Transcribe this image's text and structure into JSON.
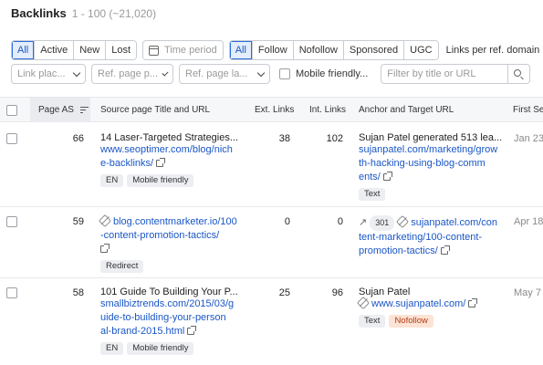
{
  "header": {
    "title": "Backlinks",
    "count": "1 - 100 (~21,020)"
  },
  "status_filter": [
    {
      "label": "All",
      "active": true
    },
    {
      "label": "Active",
      "active": false
    },
    {
      "label": "New",
      "active": false
    },
    {
      "label": "Lost",
      "active": false
    }
  ],
  "time_period_placeholder": "Time period",
  "type_filter": [
    {
      "label": "All",
      "active": true
    },
    {
      "label": "Follow",
      "active": false
    },
    {
      "label": "Nofollow",
      "active": false
    },
    {
      "label": "Sponsored",
      "active": false
    },
    {
      "label": "UGC",
      "active": false
    }
  ],
  "links_per_ref_domain": "Links per ref. domain",
  "dropdowns": {
    "link_placement": "Link plac...",
    "ref_page_p": "Ref. page p...",
    "ref_page_la": "Ref. page la..."
  },
  "mobile_friendly_label": "Mobile friendly...",
  "filter_placeholder": "Filter by title or URL",
  "columns": {
    "page_as": "Page AS",
    "source": "Source page Title and URL",
    "ext_links": "Ext. Links",
    "int_links": "Int. Links",
    "anchor": "Anchor and Target URL",
    "first_seen": "First Se"
  },
  "rows": [
    {
      "page_as": "66",
      "title": "14 Laser-Targeted Strategies...",
      "source_url_lines": [
        "www.seoptimer.com/blog/nich",
        "e-backlinks/"
      ],
      "source_tags": [
        "EN",
        "Mobile friendly"
      ],
      "ext_links": "38",
      "int_links": "102",
      "anchor_text": "Sujan Patel generated 513 lea...",
      "target_url_lines": [
        "sujanpatel.com/marketing/grow",
        "th-hacking-using-blog-comm",
        "ents/"
      ],
      "anchor_tags": [
        "Text"
      ],
      "first_seen": "Jan 23"
    },
    {
      "page_as": "59",
      "source_url_lines": [
        "blog.contentmarketer.io/100",
        "-content-promotion-tactics/"
      ],
      "source_tags": [
        "Redirect"
      ],
      "ext_links": "0",
      "int_links": "0",
      "redirect_code": "301",
      "target_url_lines": [
        "sujanpatel.com/con",
        "tent-marketing/100-content-",
        "promotion-tactics/"
      ],
      "first_seen": "Apr 18"
    },
    {
      "page_as": "58",
      "title": "101 Guide To Building Your P...",
      "source_url_lines": [
        "smallbiztrends.com/2015/03/g",
        "uide-to-building-your-person",
        "al-brand-2015.html"
      ],
      "source_tags": [
        "EN",
        "Mobile friendly"
      ],
      "ext_links": "25",
      "int_links": "96",
      "anchor_text": "Sujan Patel",
      "target_url_lines": [
        "www.sujanpatel.com/"
      ],
      "anchor_tags": [
        "Text",
        "Nofollow"
      ],
      "first_seen": "May 7"
    }
  ],
  "colors": {
    "accent": "#2d6cdf",
    "link": "#1a56c7",
    "nofollow_bg": "#fde3d6"
  }
}
